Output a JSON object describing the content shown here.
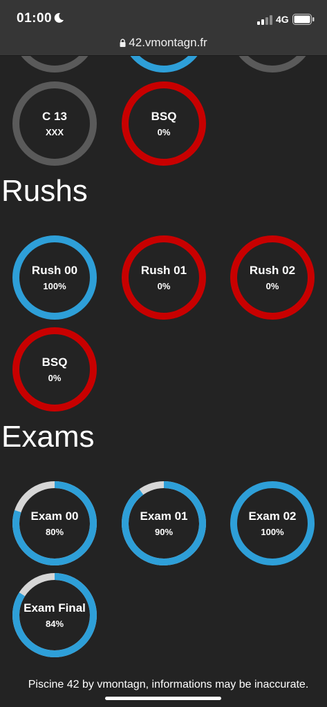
{
  "status_bar": {
    "time": "01:00",
    "network": "4G"
  },
  "browser": {
    "url": "42.vmontagn.fr"
  },
  "colors": {
    "complete": "#2e9fd8",
    "failed": "#c80000",
    "neutral": "#5a5a5a",
    "remaining": "#d6d6d6"
  },
  "top_partial_rings": [
    {
      "status": "neutral"
    },
    {
      "status": "complete"
    },
    {
      "status": "neutral"
    }
  ],
  "projects": [
    {
      "name": "C 13",
      "value": "XXX",
      "status": "neutral",
      "progress": 1.0
    },
    {
      "name": "BSQ",
      "value": "0%",
      "status": "failed",
      "progress": 1.0
    }
  ],
  "rushs": {
    "title": "Rushs",
    "items": [
      {
        "name": "Rush 00",
        "value": "100%",
        "status": "complete",
        "progress": 1.0
      },
      {
        "name": "Rush 01",
        "value": "0%",
        "status": "failed",
        "progress": 1.0
      },
      {
        "name": "Rush 02",
        "value": "0%",
        "status": "failed",
        "progress": 1.0
      },
      {
        "name": "BSQ",
        "value": "0%",
        "status": "failed",
        "progress": 1.0
      }
    ]
  },
  "exams": {
    "title": "Exams",
    "items": [
      {
        "name": "Exam 00",
        "value": "80%",
        "status": "complete",
        "progress": 0.8
      },
      {
        "name": "Exam 01",
        "value": "90%",
        "status": "complete",
        "progress": 0.9
      },
      {
        "name": "Exam 02",
        "value": "100%",
        "status": "complete",
        "progress": 1.0
      },
      {
        "name": "Exam Final",
        "value": "84%",
        "status": "complete",
        "progress": 0.84
      }
    ]
  },
  "footer": {
    "text": "Piscine 42 by vmontagn, informations may be inaccurate."
  }
}
